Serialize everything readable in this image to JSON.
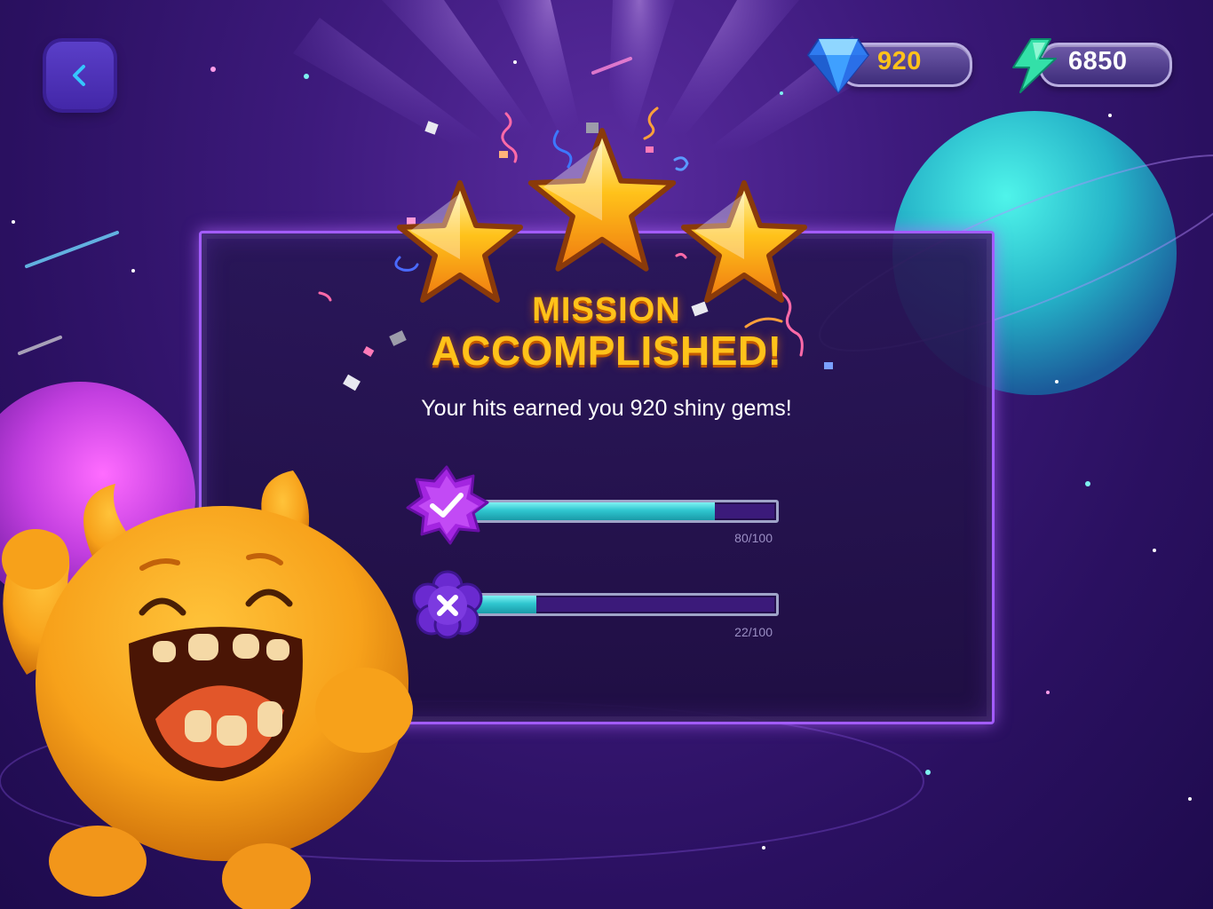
{
  "currency": {
    "gems": {
      "icon": "diamond-icon",
      "value": "920",
      "color": "#ffc21a"
    },
    "energy": {
      "icon": "lightning-icon",
      "value": "6850",
      "color": "#ffffff"
    }
  },
  "result": {
    "stars_earned": 3,
    "stars_total": 3,
    "title_line1": "MISSION",
    "title_line2": "ACCOMPLISHED!",
    "subtitle": "Your hits earned you 920 shiny gems!"
  },
  "progress": [
    {
      "icon": "checkmark-badge-icon",
      "value": 80,
      "max": 100,
      "label": "80/100"
    },
    {
      "icon": "cross-badge-icon",
      "value": 22,
      "max": 100,
      "label": "22/100"
    }
  ],
  "colors": {
    "accent": "#a35cff",
    "title": "#ffc21a",
    "bar_fill": "#2fc6cf"
  }
}
